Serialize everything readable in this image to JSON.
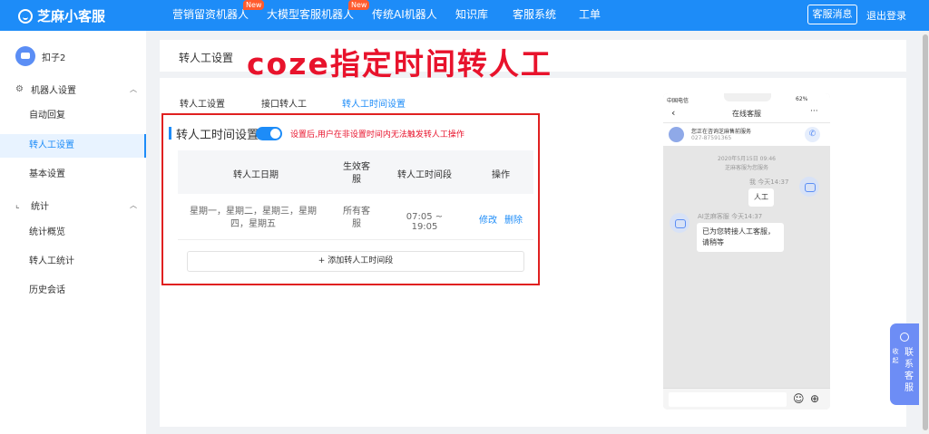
{
  "app": {
    "title": "芝麻小客服"
  },
  "topnav": {
    "items": [
      {
        "label": "营销留资机器人",
        "badge": "New"
      },
      {
        "label": "大模型客服机器人",
        "badge": "New"
      },
      {
        "label": "传统AI机器人"
      },
      {
        "label": "知识库"
      },
      {
        "label": "客服系统"
      },
      {
        "label": "工单"
      }
    ],
    "message_button": "客服消息",
    "logout": "退出登录"
  },
  "sidebar": {
    "bot_name": "扣子2",
    "groups": [
      {
        "label": "机器人设置",
        "icon": "gear-icon",
        "items": [
          "自动回复",
          "转人工设置",
          "基本设置"
        ],
        "active": "转人工设置"
      },
      {
        "label": "统计",
        "icon": "chart-icon",
        "items": [
          "统计概览",
          "转人工统计",
          "历史会话"
        ]
      }
    ]
  },
  "header": {
    "title": "转人工设置"
  },
  "overlay_title": "coze指定时间转人工",
  "tabs": [
    "转人工设置",
    "接口转人工",
    "转人工时间设置"
  ],
  "active_tab": "转人工时间设置",
  "section": {
    "title": "转人工时间设置",
    "toggle_on": true,
    "hint": "设置后,用户在非设置时间内无法触发转人工操作"
  },
  "table": {
    "headers": [
      "转人工日期",
      "生效客服",
      "转人工时间段",
      "操作"
    ],
    "rows": [
      {
        "dates": "星期一，星期二，星期三，星期四，星期五",
        "agents": "所有客服",
        "time": "07:05 ~ 19:05",
        "actions": [
          "修改",
          "删除"
        ]
      }
    ],
    "add_button": "+ 添加转人工时间段"
  },
  "phone": {
    "status_left": "中国电信",
    "status_right": "62%",
    "title": "在线客服",
    "agent_name": "您正在咨询芝麻售前服务",
    "agent_phone": "027-87591365",
    "timestamp": "2020年5月15日 09:46",
    "system_msg": "芝麻客服为您服务",
    "user_meta": "我 今天14:37",
    "user_msg": "人工",
    "bot_meta": "AI芝麻客服 今天14:37",
    "bot_msg": "已为您转接人工客服，请稍等"
  },
  "contact": {
    "collapse": "收起",
    "label": "联系客服"
  }
}
